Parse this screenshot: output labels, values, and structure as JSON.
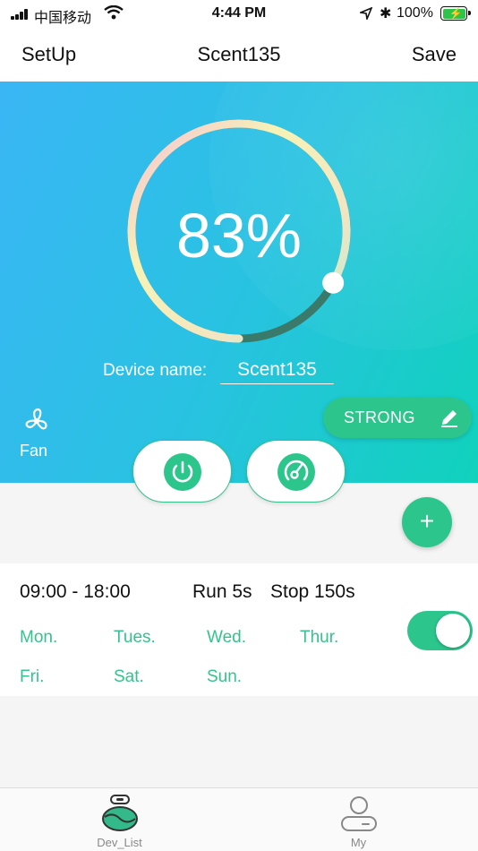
{
  "status_bar": {
    "carrier": "中国移动",
    "time": "4:44 PM",
    "battery": "100%"
  },
  "nav": {
    "left": "SetUp",
    "title": "Scent135",
    "right": "Save"
  },
  "gauge": {
    "percent_text": "83%",
    "level": 0.83
  },
  "device": {
    "label": "Device name:",
    "name": "Scent135"
  },
  "fan": {
    "label": "Fan",
    "icon": "fan-icon"
  },
  "intensity": {
    "label": "STRONG",
    "icon": "pencil-icon"
  },
  "controls": {
    "power_icon": "power-icon",
    "timer_icon": "timer-dial-icon",
    "add_label": "+"
  },
  "schedule": {
    "time_range": "09:00 - 18:00",
    "run": "Run 5s",
    "stop": "Stop 150s",
    "days": [
      "Mon.",
      "Tues.",
      "Wed.",
      "Thur.",
      "Fri.",
      "Sat.",
      "Sun."
    ],
    "enabled": true
  },
  "tabs": [
    {
      "label": "Dev_List",
      "icon": "device-list-icon",
      "active": true
    },
    {
      "label": "My",
      "icon": "user-icon",
      "active": false
    }
  ],
  "colors": {
    "accent": "#2cc58c",
    "hero_start": "#3ab6f5",
    "hero_end": "#10d2bc"
  }
}
